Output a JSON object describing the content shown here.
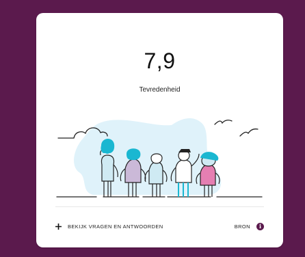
{
  "score": {
    "value": "7,9",
    "label": "Tevredenheid"
  },
  "illustration": {
    "name": "crowd-illustration",
    "colors": {
      "blob": "#dff2fa",
      "hair_teal": "#1ab7d1",
      "lavender": "#cbb9d8",
      "light_blue": "#cfeaf3",
      "pink": "#e57fb2",
      "outline": "#222222"
    }
  },
  "footer": {
    "expand_label": "BEKIJK VRAGEN EN ANTWOORDEN",
    "plus_icon": "plus-icon",
    "source_label": "BRON",
    "info_icon": "info-icon",
    "info_glyph": "i"
  },
  "colors": {
    "background": "#5b1a4d",
    "card": "#ffffff",
    "accent": "#5b1a4d"
  }
}
